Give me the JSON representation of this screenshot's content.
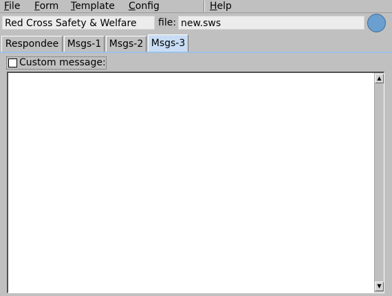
{
  "menu": {
    "items": [
      {
        "mnemonic": "F",
        "rest": "ile"
      },
      {
        "mnemonic": "F",
        "rest": "orm"
      },
      {
        "mnemonic": "T",
        "rest": "emplate"
      },
      {
        "mnemonic": "C",
        "rest": "onfig"
      },
      {
        "mnemonic": "H",
        "rest": "elp"
      }
    ]
  },
  "header": {
    "form_title": "Red Cross Safety & Welfare",
    "file_label": "file:",
    "file_name": "new.sws",
    "status_color": "#6a9fcf"
  },
  "tabs": [
    {
      "label": "Respondee"
    },
    {
      "label": "Msgs-1"
    },
    {
      "label": "Msgs-2"
    },
    {
      "label": "Msgs-3",
      "active": true
    }
  ],
  "body": {
    "custom_message_label": "Custom message:",
    "custom_message_checked": false,
    "message_text": ""
  },
  "icons": {
    "scroll_up": "arrow-up-icon",
    "scroll_down": "arrow-down-icon"
  },
  "colors": {
    "window_bg": "#c0c0c0",
    "active_tab": "#c8ddf4",
    "tab_underline": "#9dc0e6"
  }
}
